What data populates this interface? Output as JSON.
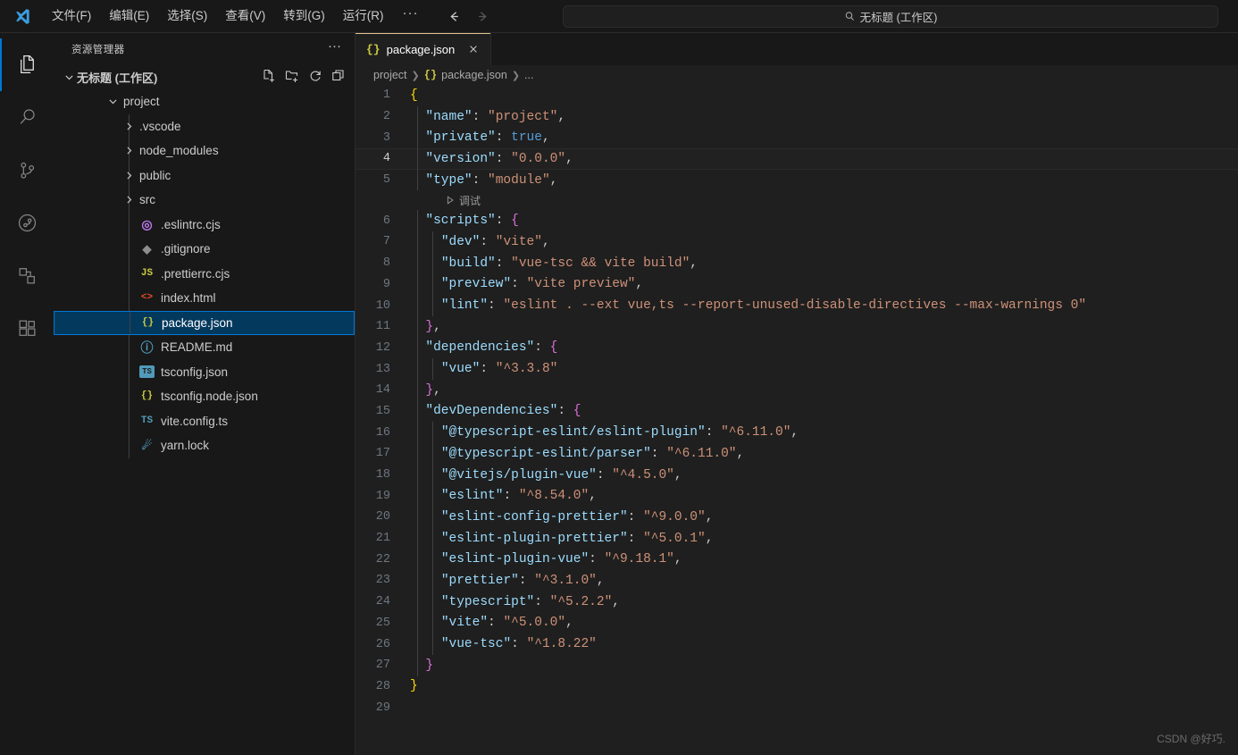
{
  "titlebar": {
    "logo_icon": "vscode-logo",
    "menus": [
      "文件(F)",
      "编辑(E)",
      "选择(S)",
      "查看(V)",
      "转到(G)",
      "运行(R)"
    ],
    "more_label": "···",
    "back_icon": "arrow-left-icon",
    "forward_icon": "arrow-right-icon",
    "search_icon": "search-icon",
    "search_title": "无标题 (工作区)"
  },
  "activitybar": {
    "items": [
      {
        "name": "explorer",
        "icon": "files-icon",
        "active": true
      },
      {
        "name": "search",
        "icon": "search-icon",
        "active": false
      },
      {
        "name": "source-control",
        "icon": "source-control-icon",
        "active": false
      },
      {
        "name": "run-and-debug",
        "icon": "debug-alt-icon",
        "active": false
      },
      {
        "name": "testing",
        "icon": "beaker-remote-icon",
        "active": false
      },
      {
        "name": "extensions",
        "icon": "extensions-icon",
        "active": false
      }
    ]
  },
  "sidebar": {
    "title": "资源管理器",
    "more_label": "···",
    "workspace": {
      "label": "无标题 (工作区)",
      "expanded": true,
      "actions": [
        {
          "name": "new-file",
          "icon": "new-file-icon"
        },
        {
          "name": "new-folder",
          "icon": "new-folder-icon"
        },
        {
          "name": "refresh",
          "icon": "refresh-icon"
        },
        {
          "name": "collapse-all",
          "icon": "collapse-all-icon"
        }
      ]
    },
    "tree": [
      {
        "label": "project",
        "type": "folder",
        "depth": 1,
        "expanded": true,
        "icon": "chevron-down-icon"
      },
      {
        "label": ".vscode",
        "type": "folder",
        "depth": 2,
        "expanded": false,
        "icon": "chevron-right-icon"
      },
      {
        "label": "node_modules",
        "type": "folder",
        "depth": 2,
        "expanded": false,
        "icon": "chevron-right-icon"
      },
      {
        "label": "public",
        "type": "folder",
        "depth": 2,
        "expanded": false,
        "icon": "chevron-right-icon"
      },
      {
        "label": "src",
        "type": "folder",
        "depth": 2,
        "expanded": false,
        "icon": "chevron-right-icon"
      },
      {
        "label": ".eslintrc.cjs",
        "type": "file",
        "depth": 2,
        "icon": "eslint-icon",
        "icon_text": "◎",
        "icon_color": "#bf7af0"
      },
      {
        "label": ".gitignore",
        "type": "file",
        "depth": 2,
        "icon": "git-icon",
        "icon_text": "◆",
        "icon_color": "#8d8d8d"
      },
      {
        "label": ".prettierrc.cjs",
        "type": "file",
        "depth": 2,
        "icon": "javascript-icon",
        "icon_text": "JS",
        "icon_color": "#cbcb41"
      },
      {
        "label": "index.html",
        "type": "file",
        "depth": 2,
        "icon": "html-icon",
        "icon_text": "<>",
        "icon_color": "#e44d26"
      },
      {
        "label": "package.json",
        "type": "file",
        "depth": 2,
        "icon": "json-icon",
        "icon_text": "{}",
        "icon_color": "#cbcb41",
        "selected": true
      },
      {
        "label": "README.md",
        "type": "file",
        "depth": 2,
        "icon": "info-icon",
        "icon_text": "ⓘ",
        "icon_color": "#519aba"
      },
      {
        "label": "tsconfig.json",
        "type": "file",
        "depth": 2,
        "icon": "typescript-icon",
        "icon_text": "TS",
        "icon_color": "#519aba"
      },
      {
        "label": "tsconfig.node.json",
        "type": "file",
        "depth": 2,
        "icon": "json-icon",
        "icon_text": "{}",
        "icon_color": "#cbcb41"
      },
      {
        "label": "vite.config.ts",
        "type": "file",
        "depth": 2,
        "icon": "typescript-icon",
        "icon_text": "TS",
        "icon_color": "#519aba"
      },
      {
        "label": "yarn.lock",
        "type": "file",
        "depth": 2,
        "icon": "yarn-icon",
        "icon_text": "☄",
        "icon_color": "#519aba"
      }
    ]
  },
  "editor": {
    "tabs": [
      {
        "label": "package.json",
        "icon": "json-icon",
        "icon_text": "{}",
        "active": true,
        "close_icon": "close-icon"
      }
    ],
    "breadcrumb": [
      "project",
      "package.json",
      "..."
    ],
    "breadcrumb_icon": "{}",
    "codelens": {
      "icon": "play-icon",
      "label": "调试",
      "after_line": 5
    },
    "active_line": 4,
    "lines": [
      {
        "n": 1,
        "indent": 0,
        "tokens": [
          {
            "t": "{",
            "c": "t-br0"
          }
        ]
      },
      {
        "n": 2,
        "indent": 1,
        "tokens": [
          {
            "t": "\"name\"",
            "c": "t-key"
          },
          {
            "t": ": ",
            "c": "t-punc"
          },
          {
            "t": "\"project\"",
            "c": "t-str"
          },
          {
            "t": ",",
            "c": "t-punc"
          }
        ]
      },
      {
        "n": 3,
        "indent": 1,
        "tokens": [
          {
            "t": "\"private\"",
            "c": "t-key"
          },
          {
            "t": ": ",
            "c": "t-punc"
          },
          {
            "t": "true",
            "c": "t-bool"
          },
          {
            "t": ",",
            "c": "t-punc"
          }
        ]
      },
      {
        "n": 4,
        "indent": 1,
        "tokens": [
          {
            "t": "\"version\"",
            "c": "t-key"
          },
          {
            "t": ": ",
            "c": "t-punc"
          },
          {
            "t": "\"0.0.0\"",
            "c": "t-str"
          },
          {
            "t": ",",
            "c": "t-punc"
          }
        ]
      },
      {
        "n": 5,
        "indent": 1,
        "tokens": [
          {
            "t": "\"type\"",
            "c": "t-key"
          },
          {
            "t": ": ",
            "c": "t-punc"
          },
          {
            "t": "\"module\"",
            "c": "t-str"
          },
          {
            "t": ",",
            "c": "t-punc"
          }
        ]
      },
      {
        "n": 6,
        "indent": 1,
        "tokens": [
          {
            "t": "\"scripts\"",
            "c": "t-key"
          },
          {
            "t": ": ",
            "c": "t-punc"
          },
          {
            "t": "{",
            "c": "t-br1"
          }
        ]
      },
      {
        "n": 7,
        "indent": 2,
        "tokens": [
          {
            "t": "\"dev\"",
            "c": "t-key"
          },
          {
            "t": ": ",
            "c": "t-punc"
          },
          {
            "t": "\"vite\"",
            "c": "t-str"
          },
          {
            "t": ",",
            "c": "t-punc"
          }
        ]
      },
      {
        "n": 8,
        "indent": 2,
        "tokens": [
          {
            "t": "\"build\"",
            "c": "t-key"
          },
          {
            "t": ": ",
            "c": "t-punc"
          },
          {
            "t": "\"vue-tsc && vite build\"",
            "c": "t-str"
          },
          {
            "t": ",",
            "c": "t-punc"
          }
        ]
      },
      {
        "n": 9,
        "indent": 2,
        "tokens": [
          {
            "t": "\"preview\"",
            "c": "t-key"
          },
          {
            "t": ": ",
            "c": "t-punc"
          },
          {
            "t": "\"vite preview\"",
            "c": "t-str"
          },
          {
            "t": ",",
            "c": "t-punc"
          }
        ]
      },
      {
        "n": 10,
        "indent": 2,
        "tokens": [
          {
            "t": "\"lint\"",
            "c": "t-key"
          },
          {
            "t": ": ",
            "c": "t-punc"
          },
          {
            "t": "\"eslint . --ext vue,ts --report-unused-disable-directives --max-warnings 0\"",
            "c": "t-str"
          }
        ]
      },
      {
        "n": 11,
        "indent": 1,
        "tokens": [
          {
            "t": "}",
            "c": "t-br1"
          },
          {
            "t": ",",
            "c": "t-punc"
          }
        ]
      },
      {
        "n": 12,
        "indent": 1,
        "tokens": [
          {
            "t": "\"dependencies\"",
            "c": "t-key"
          },
          {
            "t": ": ",
            "c": "t-punc"
          },
          {
            "t": "{",
            "c": "t-br1"
          }
        ]
      },
      {
        "n": 13,
        "indent": 2,
        "tokens": [
          {
            "t": "\"vue\"",
            "c": "t-key"
          },
          {
            "t": ": ",
            "c": "t-punc"
          },
          {
            "t": "\"^3.3.8\"",
            "c": "t-str"
          }
        ]
      },
      {
        "n": 14,
        "indent": 1,
        "tokens": [
          {
            "t": "}",
            "c": "t-br1"
          },
          {
            "t": ",",
            "c": "t-punc"
          }
        ]
      },
      {
        "n": 15,
        "indent": 1,
        "tokens": [
          {
            "t": "\"devDependencies\"",
            "c": "t-key"
          },
          {
            "t": ": ",
            "c": "t-punc"
          },
          {
            "t": "{",
            "c": "t-br1"
          }
        ]
      },
      {
        "n": 16,
        "indent": 2,
        "tokens": [
          {
            "t": "\"@typescript-eslint/eslint-plugin\"",
            "c": "t-key"
          },
          {
            "t": ": ",
            "c": "t-punc"
          },
          {
            "t": "\"^6.11.0\"",
            "c": "t-str"
          },
          {
            "t": ",",
            "c": "t-punc"
          }
        ]
      },
      {
        "n": 17,
        "indent": 2,
        "tokens": [
          {
            "t": "\"@typescript-eslint/parser\"",
            "c": "t-key"
          },
          {
            "t": ": ",
            "c": "t-punc"
          },
          {
            "t": "\"^6.11.0\"",
            "c": "t-str"
          },
          {
            "t": ",",
            "c": "t-punc"
          }
        ]
      },
      {
        "n": 18,
        "indent": 2,
        "tokens": [
          {
            "t": "\"@vitejs/plugin-vue\"",
            "c": "t-key"
          },
          {
            "t": ": ",
            "c": "t-punc"
          },
          {
            "t": "\"^4.5.0\"",
            "c": "t-str"
          },
          {
            "t": ",",
            "c": "t-punc"
          }
        ]
      },
      {
        "n": 19,
        "indent": 2,
        "tokens": [
          {
            "t": "\"eslint\"",
            "c": "t-key"
          },
          {
            "t": ": ",
            "c": "t-punc"
          },
          {
            "t": "\"^8.54.0\"",
            "c": "t-str"
          },
          {
            "t": ",",
            "c": "t-punc"
          }
        ]
      },
      {
        "n": 20,
        "indent": 2,
        "tokens": [
          {
            "t": "\"eslint-config-prettier\"",
            "c": "t-key"
          },
          {
            "t": ": ",
            "c": "t-punc"
          },
          {
            "t": "\"^9.0.0\"",
            "c": "t-str"
          },
          {
            "t": ",",
            "c": "t-punc"
          }
        ]
      },
      {
        "n": 21,
        "indent": 2,
        "tokens": [
          {
            "t": "\"eslint-plugin-prettier\"",
            "c": "t-key"
          },
          {
            "t": ": ",
            "c": "t-punc"
          },
          {
            "t": "\"^5.0.1\"",
            "c": "t-str"
          },
          {
            "t": ",",
            "c": "t-punc"
          }
        ]
      },
      {
        "n": 22,
        "indent": 2,
        "tokens": [
          {
            "t": "\"eslint-plugin-vue\"",
            "c": "t-key"
          },
          {
            "t": ": ",
            "c": "t-punc"
          },
          {
            "t": "\"^9.18.1\"",
            "c": "t-str"
          },
          {
            "t": ",",
            "c": "t-punc"
          }
        ]
      },
      {
        "n": 23,
        "indent": 2,
        "tokens": [
          {
            "t": "\"prettier\"",
            "c": "t-key"
          },
          {
            "t": ": ",
            "c": "t-punc"
          },
          {
            "t": "\"^3.1.0\"",
            "c": "t-str"
          },
          {
            "t": ",",
            "c": "t-punc"
          }
        ]
      },
      {
        "n": 24,
        "indent": 2,
        "tokens": [
          {
            "t": "\"typescript\"",
            "c": "t-key"
          },
          {
            "t": ": ",
            "c": "t-punc"
          },
          {
            "t": "\"^5.2.2\"",
            "c": "t-str"
          },
          {
            "t": ",",
            "c": "t-punc"
          }
        ]
      },
      {
        "n": 25,
        "indent": 2,
        "tokens": [
          {
            "t": "\"vite\"",
            "c": "t-key"
          },
          {
            "t": ": ",
            "c": "t-punc"
          },
          {
            "t": "\"^5.0.0\"",
            "c": "t-str"
          },
          {
            "t": ",",
            "c": "t-punc"
          }
        ]
      },
      {
        "n": 26,
        "indent": 2,
        "tokens": [
          {
            "t": "\"vue-tsc\"",
            "c": "t-key"
          },
          {
            "t": ": ",
            "c": "t-punc"
          },
          {
            "t": "\"^1.8.22\"",
            "c": "t-str"
          }
        ]
      },
      {
        "n": 27,
        "indent": 1,
        "tokens": [
          {
            "t": "}",
            "c": "t-br1"
          }
        ]
      },
      {
        "n": 28,
        "indent": 0,
        "tokens": [
          {
            "t": "}",
            "c": "t-br0"
          }
        ]
      },
      {
        "n": 29,
        "indent": 0,
        "tokens": []
      }
    ]
  },
  "watermark": "CSDN @好巧."
}
